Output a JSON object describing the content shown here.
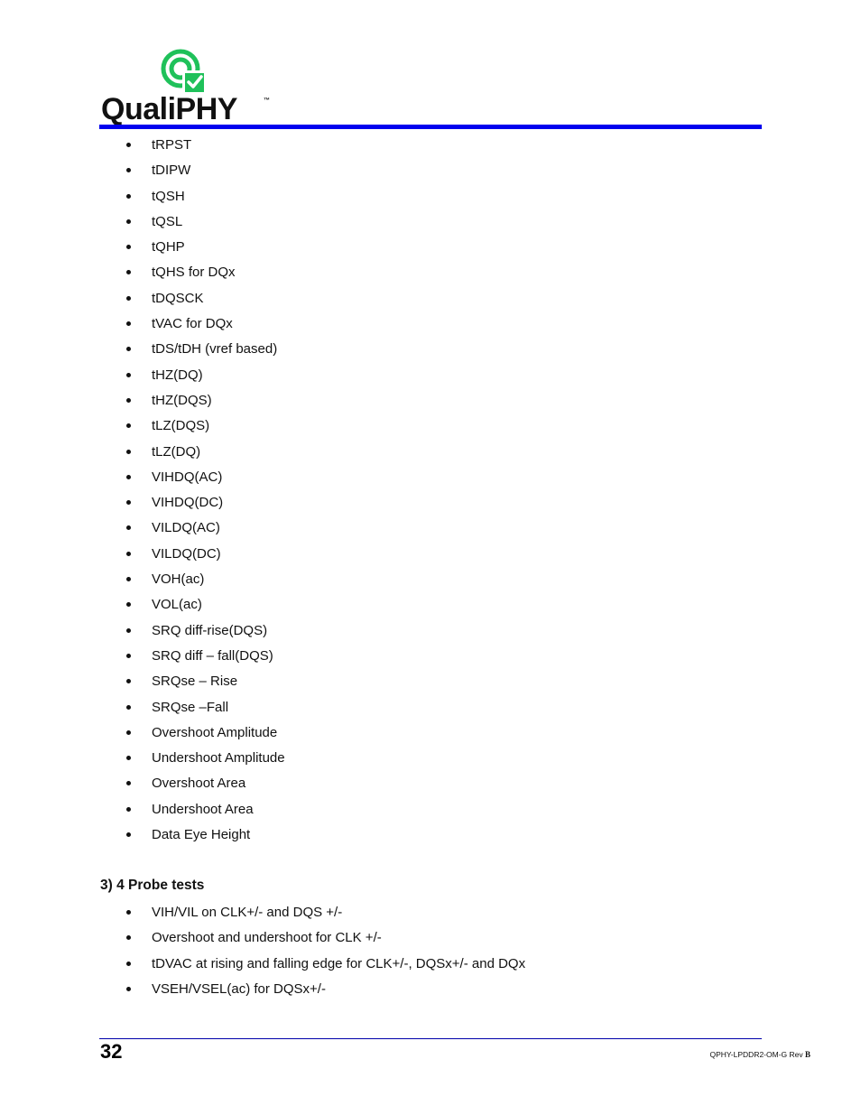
{
  "header": {
    "logo_text": "QualiPHY",
    "logo_trademark": "™",
    "logo_icon": "target-check-icon",
    "rule_color": "#0000ee",
    "brand_green": "#1fc15a"
  },
  "main_list": {
    "items": [
      "tRPST",
      "tDIPW",
      "tQSH",
      "tQSL",
      "tQHP",
      "tQHS for DQx",
      "tDQSCK",
      "tVAC for DQx",
      "tDS/tDH (vref based)",
      "tHZ(DQ)",
      "tHZ(DQS)",
      "tLZ(DQS)",
      "tLZ(DQ)",
      "VIHDQ(AC)",
      "VIHDQ(DC)",
      "VILDQ(AC)",
      "VILDQ(DC)",
      "VOH(ac)",
      "VOL(ac)",
      "SRQ diff-rise(DQS)",
      "SRQ diff – fall(DQS)",
      "SRQse – Rise",
      "SRQse –Fall",
      "Overshoot Amplitude",
      "Undershoot Amplitude",
      "Overshoot Area",
      "Undershoot Area",
      "Data Eye Height"
    ]
  },
  "probe_section": {
    "heading": "3) 4 Probe tests",
    "items": [
      "VIH/VIL on CLK+/- and DQS +/-",
      "Overshoot and undershoot for CLK +/-",
      "tDVAC at rising and falling edge for CLK+/-, DQSx+/- and DQx",
      "VSEH/VSEL(ac) for DQSx+/-"
    ]
  },
  "footer": {
    "page_number": "32",
    "doc_id": "QPHY-LPDDR2-OM-G Rev ",
    "doc_rev": "B"
  }
}
